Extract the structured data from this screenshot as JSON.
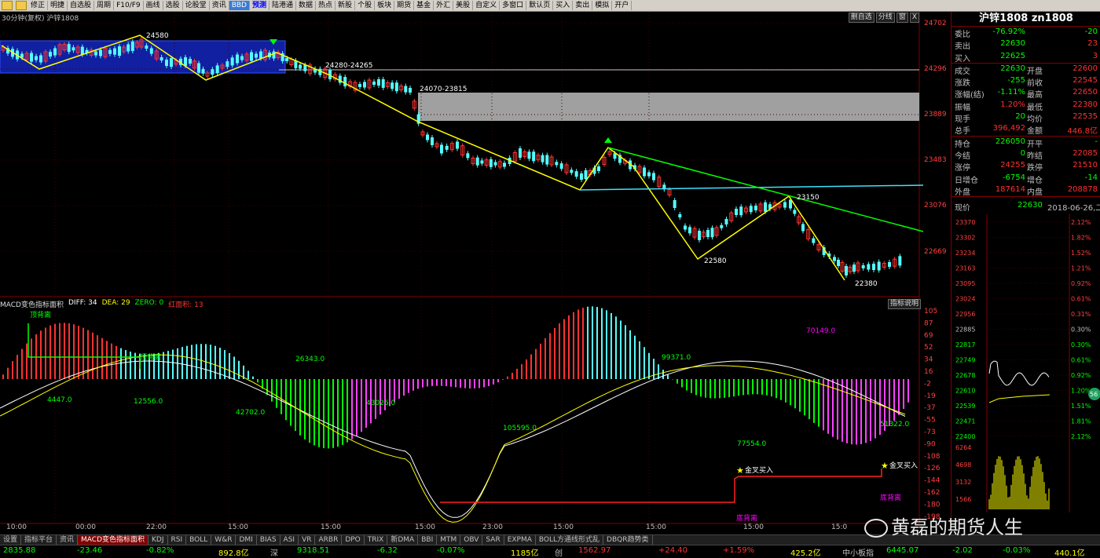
{
  "toolbar": {
    "buttons": [
      "修正",
      "明捷",
      "自选股",
      "周期",
      "F10/F9",
      "画线",
      "选股",
      "论股堂",
      "资讯",
      "BBD",
      "预测",
      "陆港通",
      "数据",
      "热点",
      "新股",
      "个股",
      "板块",
      "期货",
      "基金",
      "外汇",
      "美股",
      "自定义",
      "多窗口",
      "默认页",
      "买入",
      "卖出",
      "模拟",
      "开户"
    ]
  },
  "chart": {
    "title": "30分钟(复权)  沪锌1808",
    "top_buttons": [
      "删自选",
      "分线",
      "窗",
      "X"
    ],
    "price_axis": [
      "24702",
      "24296",
      "23889",
      "23483",
      "23076",
      "22669"
    ],
    "annotations": [
      "24580",
      "24280-24265",
      "24070-23815",
      "23150",
      "22580",
      "22380"
    ],
    "macd_axis": [
      "105",
      "87",
      "69",
      "52",
      "34",
      "16",
      "-2",
      "-19",
      "-37",
      "-55",
      "-73",
      "-90",
      "-108",
      "-126",
      "-144",
      "-162",
      "-180",
      "-198"
    ],
    "macd_labels": [
      "顶背离",
      "顶背离",
      "4447.0",
      "12556.0",
      "42702.0",
      "26343.0",
      "43026.0",
      "105595.0",
      "99371.0",
      "77554.0",
      "70149.0",
      "51322.0",
      "金叉买入",
      "金叉买入",
      "底背离",
      "底背离"
    ],
    "time_axis": [
      "10:00",
      "00:00",
      "22:00",
      "15:00",
      "15:00",
      "15:00",
      "23:00",
      "15:00",
      "15:00",
      "15:00",
      "15:0"
    ]
  },
  "macd_legend": {
    "name": "MACD变色指标面积",
    "diff": "DIFF: 34",
    "dea": "DEA: 29",
    "zero": "ZERO: 0",
    "red": "红面积: 13",
    "button": "指标说明"
  },
  "tabs": [
    "设置",
    "指标平台",
    "资讯",
    "MACD变色指标面积",
    "KDJ",
    "RSI",
    "BOLL",
    "W&R",
    "DMI",
    "BIAS",
    "ASI",
    "VR",
    "ARBR",
    "DPO",
    "TRIX",
    "新DMA",
    "BBI",
    "MTM",
    "OBV",
    "SAR",
    "EXPMA",
    "BOLL方通线形式乱",
    "DBQR趋势类"
  ],
  "active_tab": 3,
  "status": [
    "2835.88",
    "-23.46",
    "-0.82%",
    "892.8亿",
    "深",
    "9318.51",
    "-6.32",
    "-0.07%",
    "1185亿",
    "创",
    "1562.97",
    "+24.40",
    "+1.59%",
    "425.2亿",
    "中小板指",
    "6445.07",
    "-2.02",
    "-0.03%",
    "440.1亿"
  ],
  "right_panel": {
    "title": "沪锌1808 zn1808",
    "rows": [
      {
        "l1": "委比",
        "v1": "-76.92%",
        "l2": "",
        "v2": "-20"
      },
      {
        "l1": "卖出",
        "v1": "22630",
        "l2": "",
        "v2": "23"
      },
      {
        "l1": "买入",
        "v1": "22625",
        "l2": "",
        "v2": "3"
      },
      {
        "l1": "成交",
        "v1": "22630",
        "l2": "开盘",
        "v2": "22600"
      },
      {
        "l1": "涨跌",
        "v1": "-255",
        "l2": "前收",
        "v2": "22545"
      },
      {
        "l1": "涨幅(结)",
        "v1": "-1.11%",
        "l2": "最高",
        "v2": "22650"
      },
      {
        "l1": "振幅",
        "v1": "1.20%",
        "l2": "最低",
        "v2": "22380"
      },
      {
        "l1": "现手",
        "v1": "20",
        "l2": "均价",
        "v2": "22535"
      },
      {
        "l1": "总手",
        "v1": "396,492",
        "l2": "金额",
        "v2": "446.8亿"
      },
      {
        "l1": "持仓",
        "v1": "226050",
        "l2": "开平",
        "v2": "-"
      },
      {
        "l1": "今结",
        "v1": "0",
        "l2": "昨结",
        "v2": "22085"
      },
      {
        "l1": "涨停",
        "v1": "24255",
        "l2": "跌停",
        "v2": "21510"
      },
      {
        "l1": "日增仓",
        "v1": "-6754",
        "l2": "增仓",
        "v2": "-14"
      },
      {
        "l1": "外盘",
        "v1": "187614",
        "l2": "内盘",
        "v2": "208878"
      }
    ],
    "now_label": "现价",
    "now_price": "22630",
    "date": "2018-06-26,二",
    "mini_left": [
      "23370",
      "23302",
      "23234",
      "23163",
      "23095",
      "23024",
      "22956",
      "22885",
      "22817",
      "22749",
      "22678",
      "22610",
      "22539",
      "22471",
      "22400",
      "6264",
      "4698",
      "3132",
      "1566"
    ],
    "mini_right": [
      "2.12%",
      "1.82%",
      "1.52%",
      "1.21%",
      "0.92%",
      "0.61%",
      "0.31%",
      "0.30%",
      "0.30%",
      "0.61%",
      "0.92%",
      "1.20%",
      "1.51%",
      "1.81%",
      "2.12%"
    ],
    "badge": "56"
  },
  "watermark": "黄磊的期货人生",
  "colors": {
    "up": "#ff3232",
    "down": "#54ffff",
    "yellow": "#ffff00",
    "green": "#00ff00",
    "magenta": "#ff00ff"
  }
}
